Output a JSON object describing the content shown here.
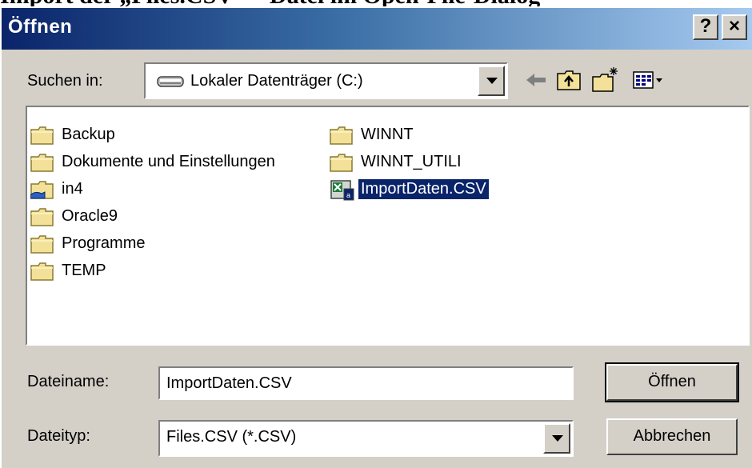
{
  "page": {
    "heading": "Import der „Files.CSV“ – Datei im Open-File-Dialog"
  },
  "window": {
    "title": "Öffnen",
    "help_label": "?",
    "close_label": "×"
  },
  "lookin": {
    "label": "Suchen in:",
    "value": "Lokaler Datenträger (C:)",
    "icon": "drive-icon"
  },
  "toolbar": [
    {
      "name": "back-arrow-icon"
    },
    {
      "name": "up-folder-icon"
    },
    {
      "name": "new-folder-icon"
    },
    {
      "name": "view-menu-icon"
    }
  ],
  "files": {
    "col1": [
      {
        "label": "Backup",
        "icon": "folder-icon"
      },
      {
        "label": "Dokumente und Einstellungen",
        "icon": "folder-icon"
      },
      {
        "label": "in4",
        "icon": "shared-folder-icon"
      },
      {
        "label": "Oracle9",
        "icon": "folder-icon"
      },
      {
        "label": "Programme",
        "icon": "folder-icon"
      },
      {
        "label": "TEMP",
        "icon": "folder-icon"
      }
    ],
    "col2": [
      {
        "label": "WINNT",
        "icon": "folder-icon"
      },
      {
        "label": "WINNT_UTILI",
        "icon": "folder-icon"
      },
      {
        "label": "ImportDaten.CSV",
        "icon": "csv-file-icon",
        "selected": true
      }
    ]
  },
  "filename": {
    "label": "Dateiname:",
    "value": "ImportDaten.CSV"
  },
  "filetype": {
    "label": "Dateityp:",
    "value": "Files.CSV (*.CSV)"
  },
  "buttons": {
    "open": "Öffnen",
    "cancel": "Abbrechen"
  },
  "colors": {
    "titlebar_start": "#0a246a",
    "titlebar_end": "#a6caf0",
    "dialog_bg": "#d4d0c8",
    "selection": "#0a246a"
  }
}
